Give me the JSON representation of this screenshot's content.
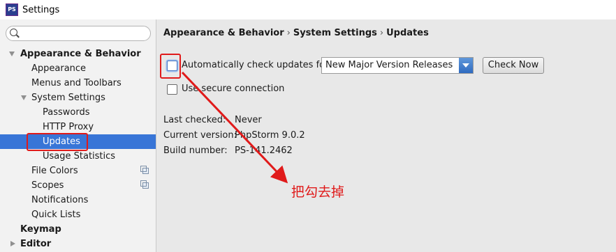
{
  "window": {
    "title": "Settings",
    "app_icon": "PS"
  },
  "sidebar": {
    "search_placeholder": "",
    "items": [
      {
        "label": "Appearance & Behavior",
        "level": 0,
        "bold": true,
        "expanded": true
      },
      {
        "label": "Appearance",
        "level": 1
      },
      {
        "label": "Menus and Toolbars",
        "level": 1
      },
      {
        "label": "System Settings",
        "level": 1,
        "expanded": true
      },
      {
        "label": "Passwords",
        "level": 2
      },
      {
        "label": "HTTP Proxy",
        "level": 2
      },
      {
        "label": "Updates",
        "level": 2,
        "selected": true
      },
      {
        "label": "Usage Statistics",
        "level": 2
      },
      {
        "label": "File Colors",
        "level": 1,
        "project_icon": true
      },
      {
        "label": "Scopes",
        "level": 1,
        "project_icon": true
      },
      {
        "label": "Notifications",
        "level": 1
      },
      {
        "label": "Quick Lists",
        "level": 1
      },
      {
        "label": "Keymap",
        "level": 0,
        "bold": true
      },
      {
        "label": "Editor",
        "level": 0,
        "bold": true,
        "collapsed": true
      }
    ]
  },
  "breadcrumb": [
    "Appearance & Behavior",
    "System Settings",
    "Updates"
  ],
  "updates": {
    "auto_check_label": "Automatically check updates for",
    "auto_check_checked": false,
    "channel_selected": "New Major Version Releases",
    "check_now_label": "Check Now",
    "secure_label": "Use secure connection",
    "secure_checked": false,
    "info": [
      {
        "key": "Last checked:",
        "value": "Never"
      },
      {
        "key": "Current version:",
        "value": "PhpStorm 9.0.2"
      },
      {
        "key": "Build number:",
        "value": "PS-141.2462"
      }
    ]
  },
  "annotation": {
    "text": "把勾去掉",
    "color": "#e01a1a"
  },
  "colors": {
    "selection": "#3875d7",
    "highlight": "#e01a1a"
  }
}
